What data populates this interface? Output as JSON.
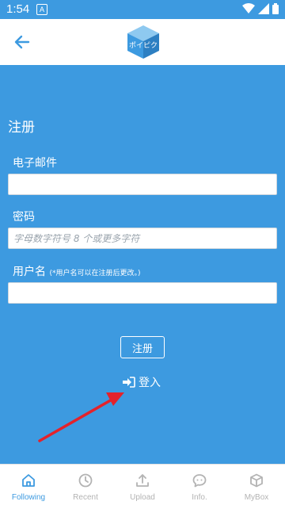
{
  "status": {
    "time": "1:54",
    "notif_letter": "A"
  },
  "logo_text": "ポイピク",
  "form": {
    "title": "注册",
    "email_label": "电子邮件",
    "email_value": "",
    "password_label": "密码",
    "password_placeholder": "字母数字符号 8 个或更多字符",
    "username_label": "用户名",
    "username_note": "(*用户名可以在注册后更改。)",
    "username_value": "",
    "register_button": "注册",
    "login_link": "登入"
  },
  "bottom_nav": [
    {
      "label": "Following",
      "icon": "home-icon",
      "active": true
    },
    {
      "label": "Recent",
      "icon": "clock-icon",
      "active": false
    },
    {
      "label": "Upload",
      "icon": "upload-icon",
      "active": false
    },
    {
      "label": "Info.",
      "icon": "chat-icon",
      "active": false
    },
    {
      "label": "MyBox",
      "icon": "box-icon",
      "active": false
    }
  ],
  "colors": {
    "primary": "#3d9ae0",
    "nav_inactive": "#b3b3b3",
    "arrow": "#e4222b"
  }
}
